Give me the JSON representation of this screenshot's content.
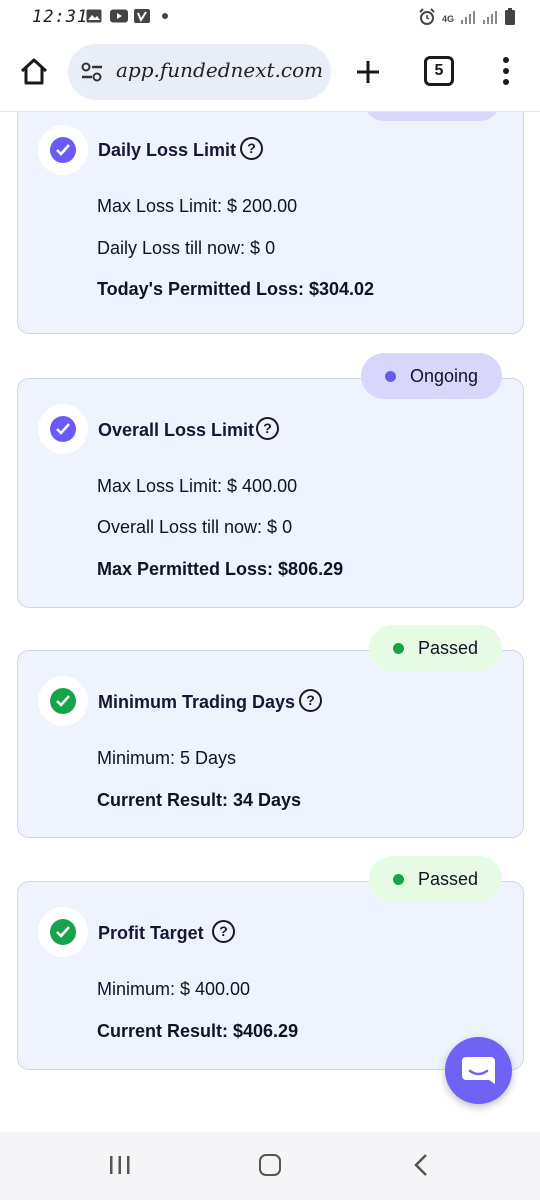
{
  "status_bar": {
    "time": "12:31",
    "network": "4G"
  },
  "browser": {
    "url": "app.fundednext.com",
    "tab_count": "5"
  },
  "cards": [
    {
      "title": "Daily Loss Limit",
      "status": {
        "label": "",
        "type": "ongoing"
      },
      "lines": [
        {
          "text": "Max Loss Limit: $ 200.00",
          "bold": false
        },
        {
          "text": "Daily Loss till now: $ 0",
          "bold": false
        },
        {
          "text": "Today's Permitted Loss: $304.02",
          "bold": true
        }
      ]
    },
    {
      "title": "Overall Loss Limit",
      "status": {
        "label": "Ongoing",
        "type": "ongoing"
      },
      "lines": [
        {
          "text": "Max Loss Limit: $ 400.00",
          "bold": false
        },
        {
          "text": "Overall Loss till now: $ 0",
          "bold": false
        },
        {
          "text": "Max Permitted Loss: $806.29",
          "bold": true
        }
      ]
    },
    {
      "title": "Minimum Trading Days",
      "status": {
        "label": "Passed",
        "type": "passed"
      },
      "lines": [
        {
          "text": "Minimum: 5 Days",
          "bold": false
        },
        {
          "text": "Current Result: 34 Days",
          "bold": true
        }
      ]
    },
    {
      "title": "Profit Target",
      "status": {
        "label": "Passed",
        "type": "passed"
      },
      "lines": [
        {
          "text": "Minimum: $ 400.00",
          "bold": false
        },
        {
          "text": "Current Result: $406.29",
          "bold": true
        }
      ]
    }
  ],
  "colors": {
    "ongoing_dot": "#6a5af9",
    "passed_dot": "#16a34a",
    "check_ongoing": "#6a5af9",
    "check_passed": "#16a34a",
    "chat_fab": "#6f62f5"
  },
  "icons": {
    "home": "home-icon",
    "site_settings": "tune-icon",
    "new_tab": "plus-icon",
    "tabs": "tab-switcher-icon",
    "menu": "more-vert-icon",
    "help": "help-circle-icon",
    "check": "check-circle-icon",
    "chat": "chat-icon"
  }
}
